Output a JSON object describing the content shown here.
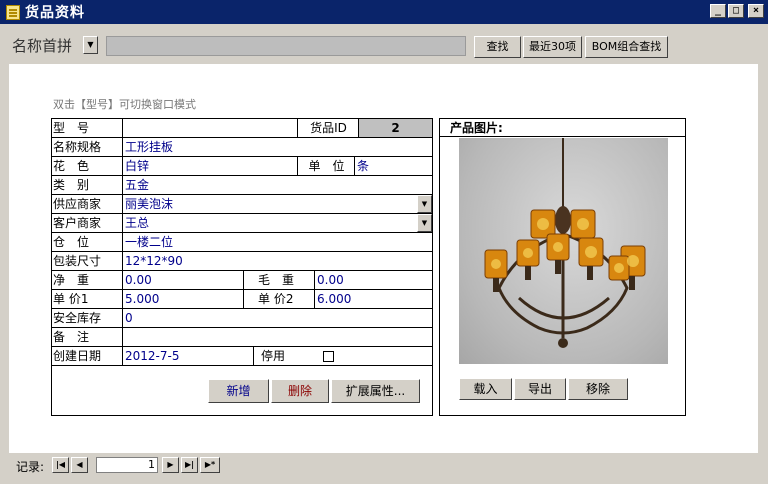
{
  "window": {
    "title": "货品资料",
    "minimize_glyph": "_",
    "maximize_glyph": "□",
    "close_glyph": "×"
  },
  "toolbar": {
    "search_field_label": "名称首拼",
    "dropdown_glyph": "▼",
    "search_value": "",
    "find_label": "查找",
    "recent30_label": "最近30项",
    "bom_find_label": "BOM组合查找"
  },
  "form": {
    "hint": "双击【型号】可切换窗口模式",
    "model_label": "型　号",
    "model_value": "",
    "goods_id_label": "货品ID",
    "goods_id_value": "2",
    "name_spec_label": "名称规格",
    "name_spec_value": "工形挂板",
    "color_label": "花　色",
    "color_value": "白锌",
    "unit_label": "单　位",
    "unit_value": "条",
    "category_label": "类　别",
    "category_value": "五金",
    "supplier_label": "供应商家",
    "supplier_value": "丽美泡沫",
    "customer_label": "客户商家",
    "customer_value": "王总",
    "warehouse_label": "仓　位",
    "warehouse_value": "一楼二位",
    "package_size_label": "包装尺寸",
    "package_size_value": "12*12*90",
    "net_weight_label": "净　重",
    "net_weight_value": "0.00",
    "gross_weight_label": "毛　重",
    "gross_weight_value": "0.00",
    "price1_label": "单 价1",
    "price1_value": "5.000",
    "price2_label": "单 价2",
    "price2_value": "6.000",
    "safety_stock_label": "安全库存",
    "safety_stock_value": "0",
    "remarks_label": "备　注",
    "remarks_value": "",
    "created_date_label": "创建日期",
    "created_date_value": "2012-7-5",
    "disabled_label": "停用",
    "disabled_checked": false,
    "add_label": "新增",
    "delete_label": "删除",
    "extend_label": "扩展属性...",
    "combo_glyph": "▼"
  },
  "image_panel": {
    "title": "产品图片:",
    "load_label": "载入",
    "export_label": "导出",
    "remove_label": "移除"
  },
  "navigator": {
    "label": "记录:",
    "first_glyph": "|◀",
    "prev_glyph": "◀",
    "current_record": "1",
    "next_glyph": "▶",
    "last_glyph": "▶|",
    "new_glyph": "▶*"
  },
  "colors": {
    "titlebar": "#0a246a",
    "field_value_text": "#00008b",
    "delete_text": "#8b0000",
    "add_text": "#00008b"
  }
}
